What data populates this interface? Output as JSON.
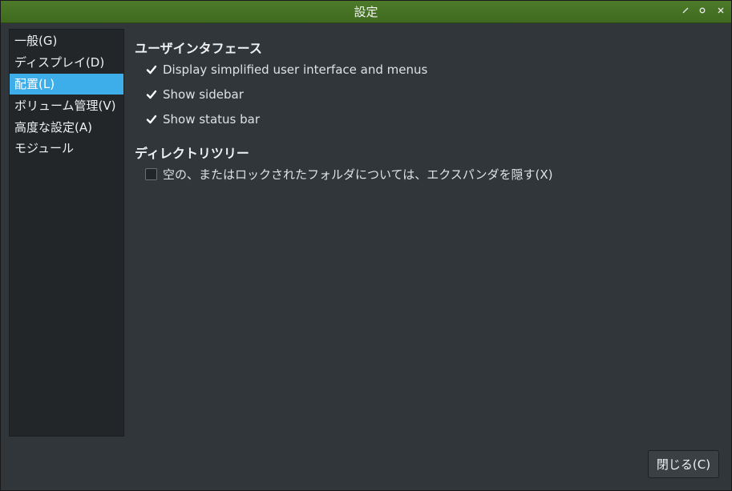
{
  "window": {
    "title": "設定"
  },
  "titlebar_icons": {
    "minimize": "minimize-icon",
    "maximize": "maximize-icon",
    "close": "close-icon"
  },
  "sidebar": {
    "items": [
      {
        "label": "一般(G)"
      },
      {
        "label": "ディスプレイ(D)"
      },
      {
        "label": "配置(L)",
        "selected": true
      },
      {
        "label": "ボリューム管理(V)"
      },
      {
        "label": "高度な設定(A)"
      },
      {
        "label": "モジュール"
      }
    ]
  },
  "ui_section": {
    "title": "ユーザインタフェース",
    "options": [
      {
        "label": "Display simplified user interface and menus",
        "checked": true
      },
      {
        "label": "Show sidebar",
        "checked": true
      },
      {
        "label": "Show status bar",
        "checked": true
      }
    ]
  },
  "tree_section": {
    "title": "ディレクトリツリー",
    "options": [
      {
        "label": "空の、またはロックされたフォルダについては、エクスパンダを隠す(X)",
        "checked": false
      }
    ]
  },
  "footer": {
    "close_label": "閉じる(C)"
  },
  "colors": {
    "titlebar": "#467325",
    "selection": "#3daee9",
    "background": "#31363b",
    "sidebar_background": "#232629"
  }
}
